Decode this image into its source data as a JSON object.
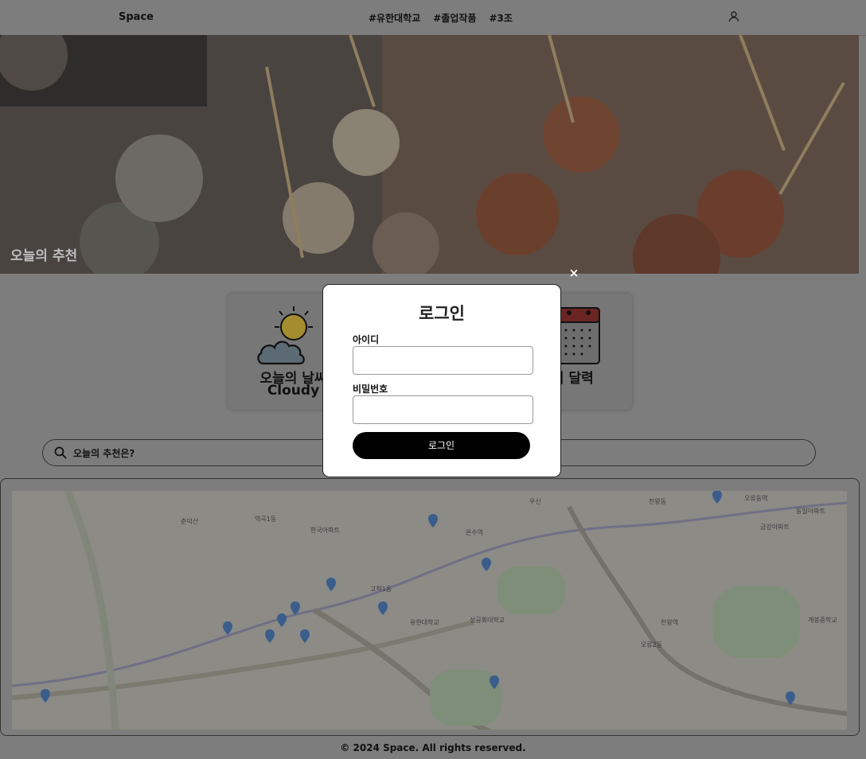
{
  "header": {
    "brand": "Space",
    "nav": [
      "#유한대학교",
      "#졸업작품",
      "#3조"
    ],
    "user_icon": "user-icon"
  },
  "hero": {
    "title": "오늘의 추천"
  },
  "cards": {
    "weather_title": "오늘의 날씨",
    "weather_value": "Cloudy",
    "weather_icon": "cloud-sun-icon",
    "calendar_title": "음식 달력",
    "calendar_icon": "calendar-icon"
  },
  "search": {
    "placeholder": "오늘의 추천은?",
    "icon": "search-icon"
  },
  "map": {
    "labels": [
      "역곡1동",
      "춘덕산",
      "한국아파트",
      "천왕역",
      "오류2동",
      "온수역",
      "유한대학교",
      "성공회대학교",
      "금강아파트",
      "동일아파트",
      "우신",
      "천왕동",
      "개봉중학교",
      "고척1동",
      "오류동역"
    ]
  },
  "footer": {
    "text": "© 2024 Space. All rights reserved."
  },
  "modal": {
    "title": "로그인",
    "id_label": "아이디",
    "pw_label": "비밀번호",
    "button": "로그인",
    "close": "×"
  }
}
